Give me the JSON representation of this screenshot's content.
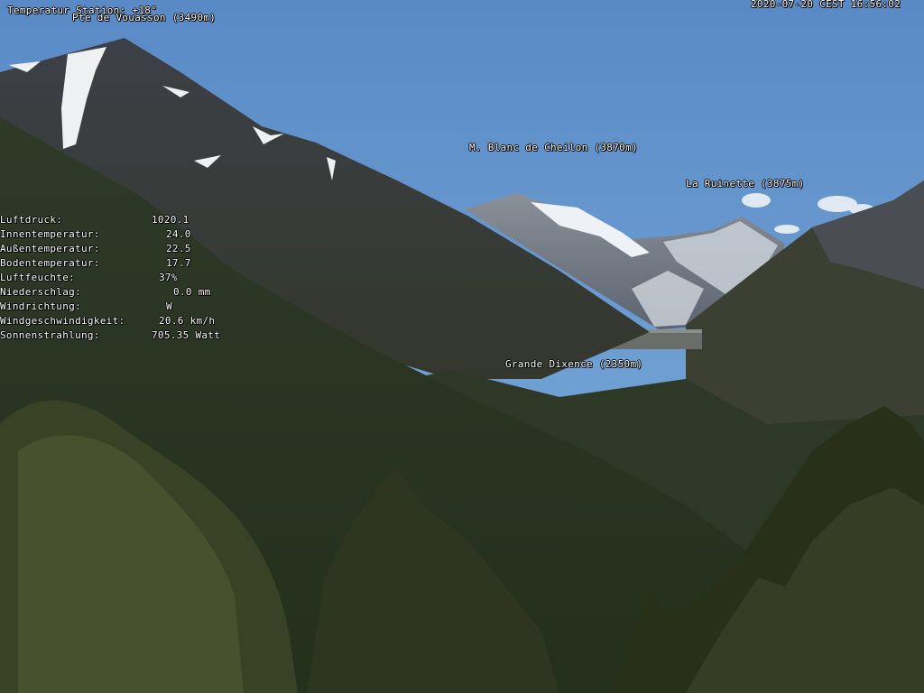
{
  "overlay": {
    "station_temperature": "Temperatur Station: +18°",
    "timestamp": "2020-07-20 CEST 16:56:02"
  },
  "peaks": [
    {
      "name": "Pte de Vouasson (3490m)"
    },
    {
      "name": "M. Blanc de Cheilon (3870m)"
    },
    {
      "name": "La Ruinette (3875m)"
    },
    {
      "name": "Grande Dixence (2350m)"
    }
  ],
  "weather": [
    {
      "label": "Luftdruck:",
      "value": "1020.1"
    },
    {
      "label": "Innentemperatur:",
      "value": "24.0"
    },
    {
      "label": "Außentemperatur:",
      "value": "22.5"
    },
    {
      "label": "Bodentemperatur:",
      "value": "17.7"
    },
    {
      "label": "Luftfeuchte:",
      "value": "37%"
    },
    {
      "label": "Niederschlag:",
      "value": "0.0 mm"
    },
    {
      "label": "Windrichtung:",
      "value": "W"
    },
    {
      "label": "Windgeschwindigkeit:",
      "value": "20.6 km/h"
    },
    {
      "label": "Sonnenstrahlung:",
      "value": "705.35 Watt"
    }
  ],
  "colors": {
    "sky_top": "#5a8ac6",
    "sky_bottom": "#7aaad8",
    "rock": "#4a4d52",
    "forest": "#2a3a22",
    "snow": "#f0f2f4"
  }
}
